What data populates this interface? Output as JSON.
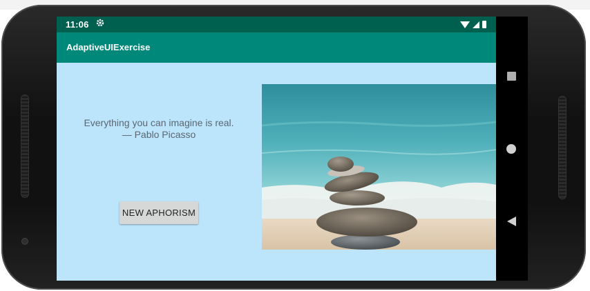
{
  "status_bar": {
    "time": "11:06",
    "settings_glyph": "✱"
  },
  "app_bar": {
    "title": "AdaptiveUIExercise"
  },
  "content": {
    "quote_text": "Everything you can imagine is real.",
    "quote_author": "— Pablo Picasso",
    "button_label": "NEW APHORISM",
    "image_subject": "stacked stones on a beach"
  },
  "nav_bar": {
    "recents": "recents-square-icon",
    "home": "home-circle-icon",
    "back": "back-triangle-icon"
  },
  "colors": {
    "status_bar": "#00604f",
    "app_bar": "#00897b",
    "content_bg": "#bce5fb",
    "button_bg": "#d6d7d7"
  }
}
